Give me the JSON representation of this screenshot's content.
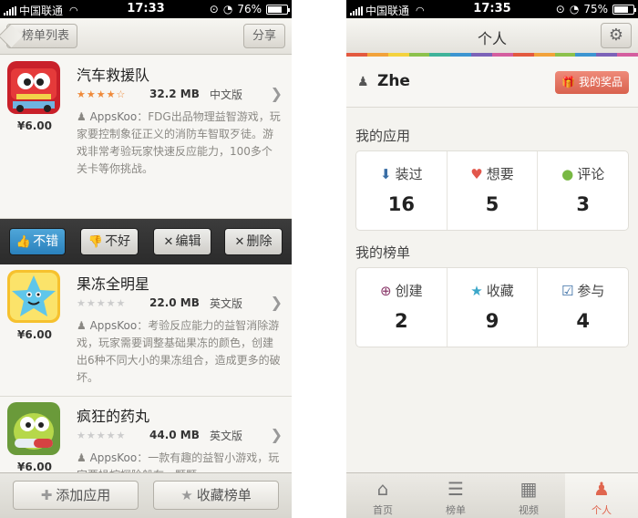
{
  "status_left": {
    "carrier": "中国联通",
    "time": "17:33",
    "battery": "76%",
    "battery_level": 0.76
  },
  "status_right": {
    "carrier": "中国联通",
    "time": "17:35",
    "battery": "75%",
    "battery_level": 0.75
  },
  "left_nav": {
    "back_label": "榜单列表",
    "share_label": "分享"
  },
  "apps": [
    {
      "name": "汽车救援队",
      "price": "¥6.00",
      "rating": 4.5,
      "size": "32.2 MB",
      "lang": "中文版",
      "author": "AppsKoo",
      "desc": "：FDG出品物理益智游戏，玩家要控制象征正义的消防车智取歹徒。游戏非常考验玩家快速反应能力，100多个关卡等你挑战。"
    },
    {
      "name": "果冻全明星",
      "price": "¥6.00",
      "rating": 0,
      "size": "22.0 MB",
      "lang": "英文版",
      "author": "AppsKoo",
      "desc": "：考验反应能力的益智消除游戏，玩家需要调整基础果冻的颜色，创建出6种不同大小的果冻组合，造成更多的破坏。"
    },
    {
      "name": "疯狂的药丸",
      "price": "¥6.00",
      "rating": 0,
      "size": "44.0 MB",
      "lang": "英文版",
      "author": "AppsKoo",
      "desc": "：一款有趣的益智小游戏，玩家要操控探险船在一颗颗"
    }
  ],
  "actions": {
    "like": "不错",
    "dislike": "不好",
    "edit": "编辑",
    "delete": "删除"
  },
  "left_toolbar": {
    "add_app": "添加应用",
    "fav_list": "收藏榜单"
  },
  "right_nav": {
    "title": "个人"
  },
  "color_strip": [
    "#e3593f",
    "#f2a23a",
    "#f4d23e",
    "#8cc14c",
    "#3fb39a",
    "#3c95d1",
    "#7c62b8",
    "#d45e9f",
    "#e3593f",
    "#f2a23a",
    "#8cc14c",
    "#3c95d1",
    "#7c62b8",
    "#d45e9f"
  ],
  "user": {
    "name": "Zhe",
    "prize_label": "我的奖品"
  },
  "my_apps": {
    "title": "我的应用",
    "stats": [
      {
        "label": "装过",
        "value": "16",
        "icon": "download-box-icon",
        "color": "#3a6ea5"
      },
      {
        "label": "想要",
        "value": "5",
        "icon": "heart-icon",
        "color": "#e2574c"
      },
      {
        "label": "评论",
        "value": "3",
        "icon": "comment-bubble-icon",
        "color": "#78b843"
      }
    ]
  },
  "my_lists": {
    "title": "我的榜单",
    "stats": [
      {
        "label": "创建",
        "value": "2",
        "icon": "plus-circle-icon",
        "color": "#8b3a6b"
      },
      {
        "label": "收藏",
        "value": "9",
        "icon": "star-icon",
        "color": "#3ba7c9"
      },
      {
        "label": "参与",
        "value": "4",
        "icon": "checkbox-icon",
        "color": "#3a6ea5"
      }
    ]
  },
  "tabs": [
    {
      "label": "首页",
      "icon": "home-icon"
    },
    {
      "label": "榜单",
      "icon": "list-icon"
    },
    {
      "label": "视频",
      "icon": "clapperboard-icon"
    },
    {
      "label": "个人",
      "icon": "person-icon",
      "active": true
    }
  ]
}
